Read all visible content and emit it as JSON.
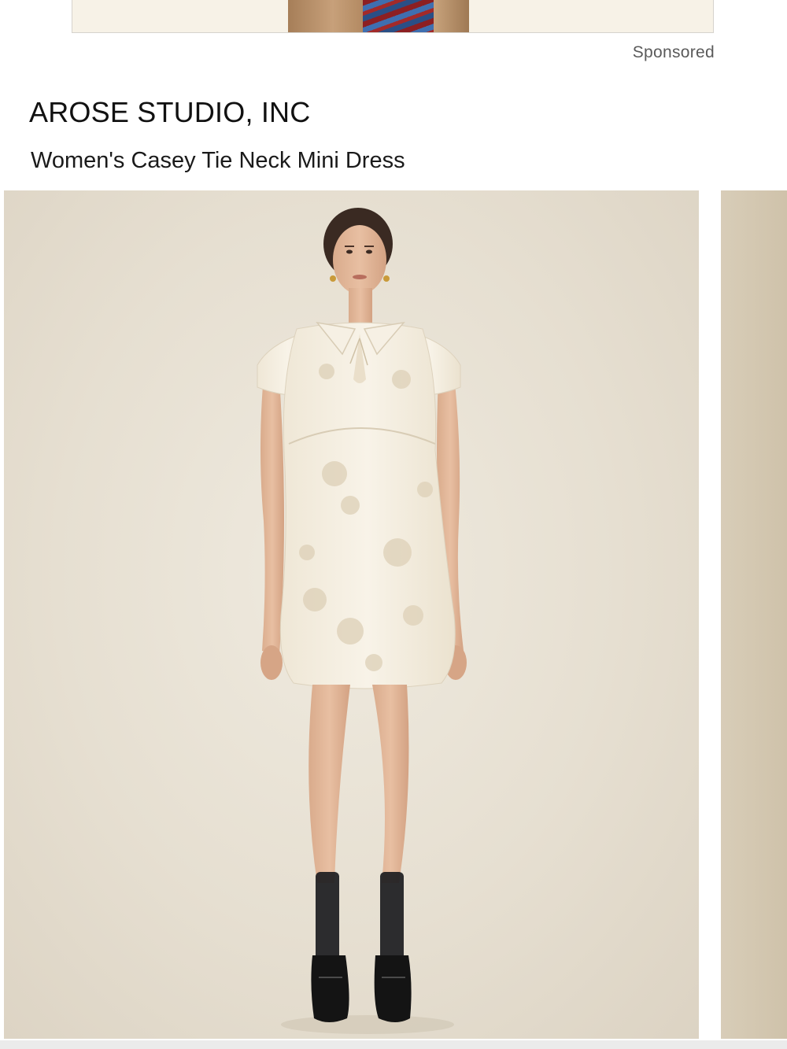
{
  "ad": {
    "sponsored_label": "Sponsored"
  },
  "product": {
    "brand": "AROSE STUDIO, INC",
    "title": "Women's Casey Tie Neck Mini Dress"
  },
  "colors": {
    "background": "#ffffff",
    "photo_backdrop": "#e6dfd1",
    "dress": "#f4efe3",
    "ad_banner": "#f7f2e7"
  },
  "icons": [
    "product-model-photo",
    "ad-photo"
  ]
}
